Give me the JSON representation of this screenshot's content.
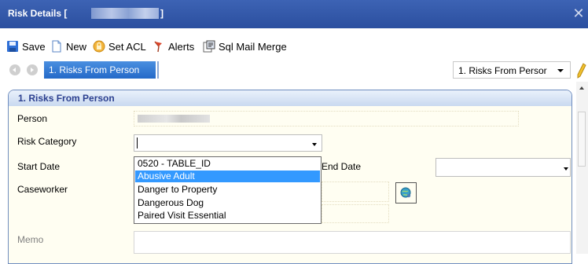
{
  "window": {
    "title": "Risk Details [",
    "title_end": "]"
  },
  "toolbar": {
    "save": "Save",
    "new": "New",
    "set_acl": "Set ACL",
    "alerts": "Alerts",
    "sql_mail_merge": "Sql Mail Merge"
  },
  "nav": {
    "active_tab": "1. Risks From Person",
    "selector_value": "1. Risks From Persor"
  },
  "panel": {
    "title": "1. Risks From Person",
    "person_label": "Person",
    "risk_category_label": "Risk Category",
    "risk_category_value": "",
    "start_date_label": "Start Date",
    "end_date_label": "End Date",
    "caseworker_label": "Caseworker",
    "memo_label": "Memo"
  },
  "dropdown": {
    "options": [
      "0520 - TABLE_ID",
      "Abusive Adult",
      "Danger to Property",
      "Dangerous Dog",
      "Paired Visit Essential"
    ],
    "selected": "Abusive Adult"
  },
  "colors": {
    "titlebar": "#2f55a6",
    "active_tab": "#2f79d4",
    "selection": "#3399ff",
    "panel_bg": "#fffef2"
  }
}
